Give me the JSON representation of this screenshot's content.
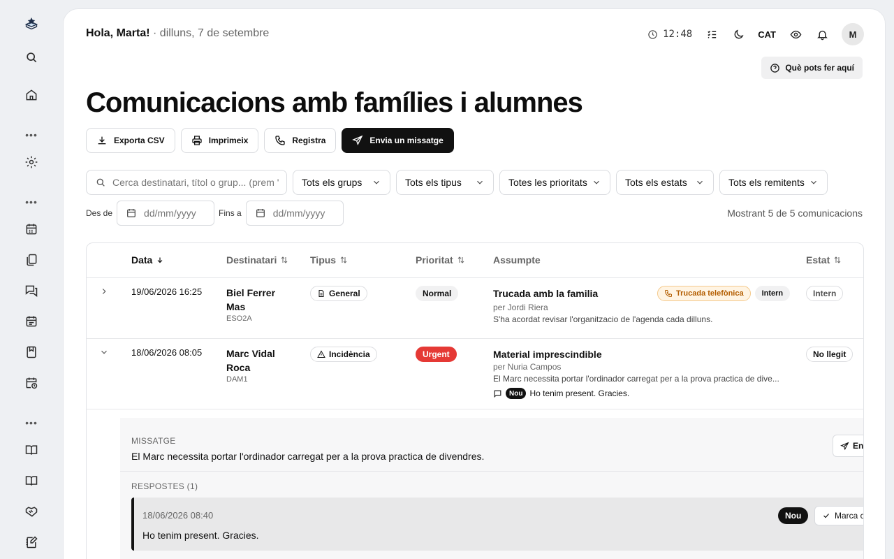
{
  "sidebar": {
    "logo": "app-logo",
    "items": [
      "search-icon",
      "home-icon",
      "settings-icon",
      "calendar-icon",
      "documents-icon",
      "messages-icon",
      "schedule-icon",
      "bookmark-icon",
      "calendar-clock-icon",
      "book-icon",
      "book-open-icon",
      "handshake-icon",
      "notebook-icon"
    ],
    "dots": "•••"
  },
  "header": {
    "greeting": "Hola, Marta!",
    "date": " · dilluns, 7 de setembre",
    "time": "12:48",
    "language": "CAT",
    "avatar_initial": "M",
    "help_label": "Què pots fer aquí"
  },
  "page": {
    "title": "Comunicacions amb famílies i alumnes"
  },
  "actions": {
    "export": "Exporta CSV",
    "print": "Imprimeix",
    "register": "Registra",
    "send": "Envia un missatge"
  },
  "filters": {
    "search_placeholder": "Cerca destinatari, títol o grup... (prem '",
    "groups": "Tots els grups",
    "types": "Tots els tipus",
    "priorities": "Totes les prioritats",
    "states": "Tots els estats",
    "senders": "Tots els remitents",
    "from_label": "Des de",
    "to_label": "Fins a",
    "date_placeholder": "dd/mm/yyyy",
    "count_text": "Mostrant 5 de 5 comunicacions"
  },
  "table": {
    "columns": {
      "date": "Data",
      "recipient": "Destinatari",
      "type": "Tipus",
      "priority": "Prioritat",
      "subject": "Assumpte",
      "state": "Estat"
    },
    "rows": [
      {
        "date": "19/06/2026 16:25",
        "recipient": "Biel Ferrer Mas",
        "group": "ESO2A",
        "type": "General",
        "priority": "Normal",
        "subject": "Trucada amb la familia",
        "tag1": "Trucada telefònica",
        "tag2": "Intern",
        "author": "per Jordi Riera",
        "preview": "S'ha acordat revisar l'organitzacio de l'agenda cada dilluns.",
        "state": "Intern"
      },
      {
        "date": "18/06/2026 08:05",
        "recipient": "Marc Vidal Roca",
        "group": "DAM1",
        "type": "Incidència",
        "priority": "Urgent",
        "subject": "Material imprescindible",
        "author": "per Nuria Campos",
        "preview": "El Marc necessita portar l'ordinador carregat per a la prova practica de dive...",
        "reply_badge": "Nou",
        "reply_preview": "Ho tenim present. Gracies.",
        "state": "No llegit"
      }
    ]
  },
  "expanded": {
    "message_label": "MISSATGE",
    "message_text": "El Marc necessita portar l'ordinador carregat per a la prova practica de divendres.",
    "send_label": "Env",
    "replies_label": "RESPOSTES (1)",
    "reply_date": "18/06/2026 08:40",
    "reply_text": "Ho tenim present. Gracies.",
    "reply_badge": "Nou",
    "mark_label": "Marca c"
  }
}
